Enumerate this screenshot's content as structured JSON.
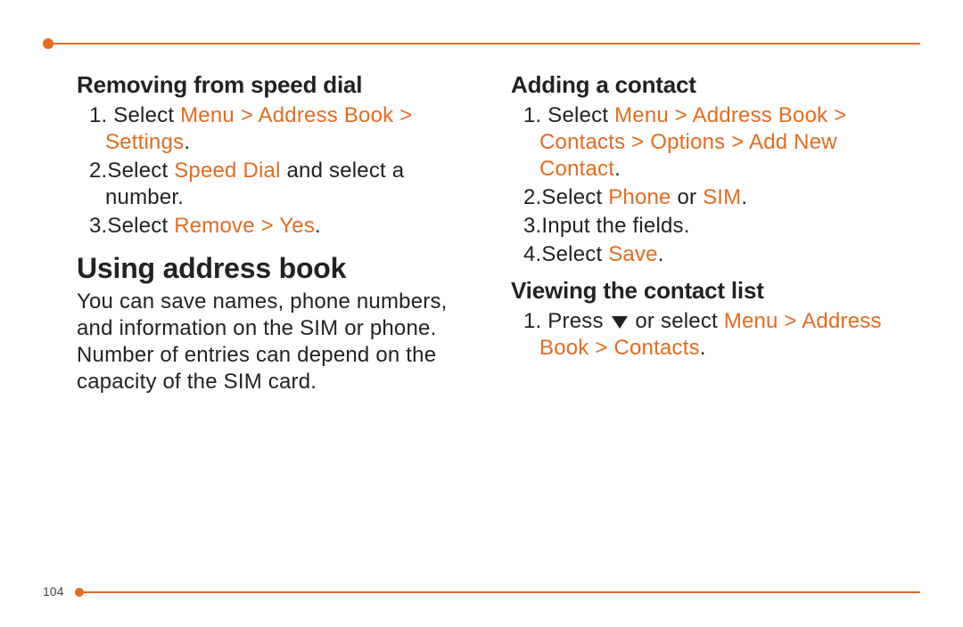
{
  "page_number": "104",
  "left": {
    "section1_title": "Removing from speed dial",
    "s1_step1_a": "Select ",
    "s1_step1_b": "Menu > Address Book > Settings",
    "s1_step1_c": ".",
    "s1_step2_a": "Select ",
    "s1_step2_b": "Speed Dial",
    "s1_step2_c": " and select a number.",
    "s1_step3_a": "Select ",
    "s1_step3_b": "Remove > Yes",
    "s1_step3_c": ".",
    "big_title": "Using address book",
    "body": "You can save names, phone numbers, and information on the SIM or phone. Number of entries can depend on the capacity of the SIM card."
  },
  "right": {
    "section2_title": "Adding a contact",
    "s2_step1_a": "Select ",
    "s2_step1_b": "Menu > Address Book > Contacts > Options > Add New Contact",
    "s2_step1_c": ".",
    "s2_step2_a": "Select ",
    "s2_step2_b": "Phone",
    "s2_step2_c": " or ",
    "s2_step2_d": "SIM",
    "s2_step2_e": ".",
    "s2_step3": "Input the fields.",
    "s2_step4_a": "Select ",
    "s2_step4_b": "Save",
    "s2_step4_c": ".",
    "section3_title": "Viewing the contact list",
    "s3_step1_a": "Press ",
    "s3_step1_b": " or select ",
    "s3_step1_c": "Menu > Address Book > Contacts",
    "s3_step1_d": "."
  }
}
